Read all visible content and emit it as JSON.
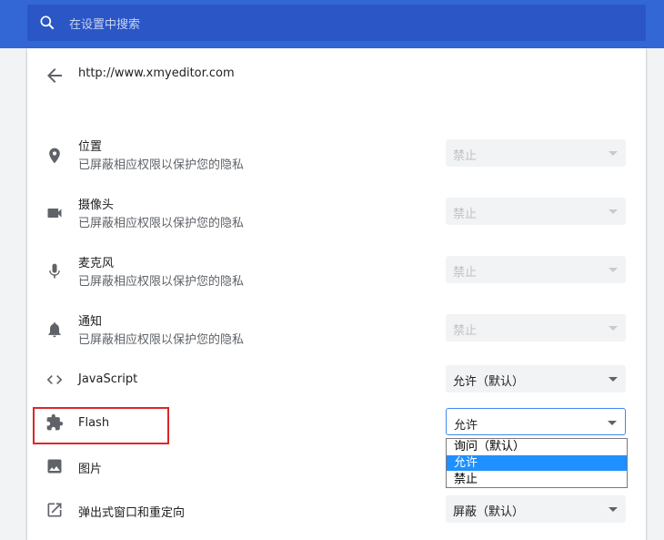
{
  "search": {
    "placeholder": "在设置中搜索",
    "icon": "search-icon"
  },
  "header": {
    "url": "http://www.xmyeditor.com",
    "back_icon": "arrow-back-icon"
  },
  "permissions": [
    {
      "name": "位置",
      "desc": "已屏蔽相应权限以保护您的隐私",
      "value": "禁止",
      "icon": "location-pin-icon",
      "state": "disabled"
    },
    {
      "name": "摄像头",
      "desc": "已屏蔽相应权限以保护您的隐私",
      "value": "禁止",
      "icon": "camera-icon",
      "state": "disabled"
    },
    {
      "name": "麦克风",
      "desc": "已屏蔽相应权限以保护您的隐私",
      "value": "禁止",
      "icon": "microphone-icon",
      "state": "disabled"
    },
    {
      "name": "通知",
      "desc": "已屏蔽相应权限以保护您的隐私",
      "value": "禁止",
      "icon": "bell-icon",
      "state": "disabled"
    },
    {
      "name": "JavaScript",
      "value": "允许（默认）",
      "icon": "code-icon",
      "state": "enabled"
    },
    {
      "name": "Flash",
      "value": "允许",
      "icon": "puzzle-icon",
      "state": "open"
    },
    {
      "name": "图片",
      "icon": "image-icon"
    },
    {
      "name": "弹出式窗口和重定向",
      "value": "屏蔽（默认）",
      "icon": "popup-icon",
      "state": "enabled"
    }
  ],
  "flash_dropdown": {
    "options": [
      "询问（默认）",
      "允许",
      "禁止"
    ],
    "selected_index": 1
  },
  "colors": {
    "topbar": "#3367d6",
    "highlight_border": "#e0262a",
    "selected_option": "#1e90ff"
  }
}
